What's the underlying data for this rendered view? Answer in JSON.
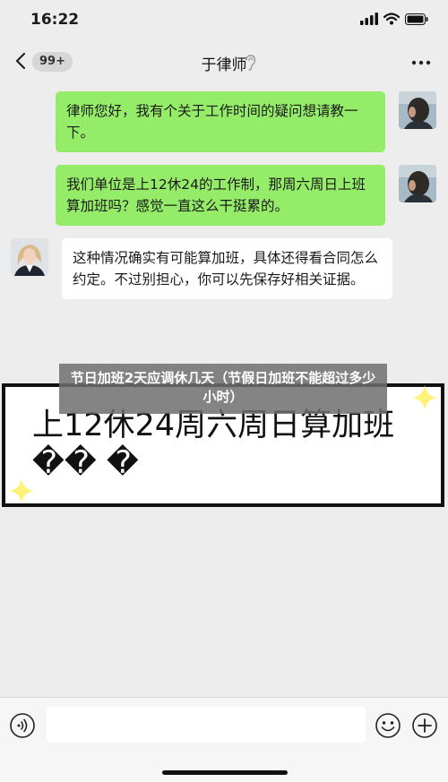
{
  "status_bar": {
    "time": "16:22"
  },
  "nav": {
    "unread_badge": "99+",
    "title": "于律师"
  },
  "messages": [
    {
      "side": "out",
      "text": "律师您好，我有个关于工作时间的疑问想请教一下。"
    },
    {
      "side": "out",
      "text": "我们单位是上12休24的工作制，那周六周日上班算加班吗？感觉一直这么干挺累的。"
    },
    {
      "side": "in",
      "text": "这种情况确实有可能算加班，具体还得看合同怎么约定。不过别担心，你可以先保存好相关证据。"
    }
  ],
  "overlay": {
    "label": "节日加班2天应调休几天（节假日加班不能超过多少小时）",
    "headline": "上12休24周六周日算加班�� �"
  },
  "input": {
    "value": "",
    "placeholder": ""
  },
  "colors": {
    "outgoing_bubble": "#95ec69",
    "incoming_bubble": "#ffffff",
    "sparkle": "#fff27a",
    "background": "#ededed"
  }
}
